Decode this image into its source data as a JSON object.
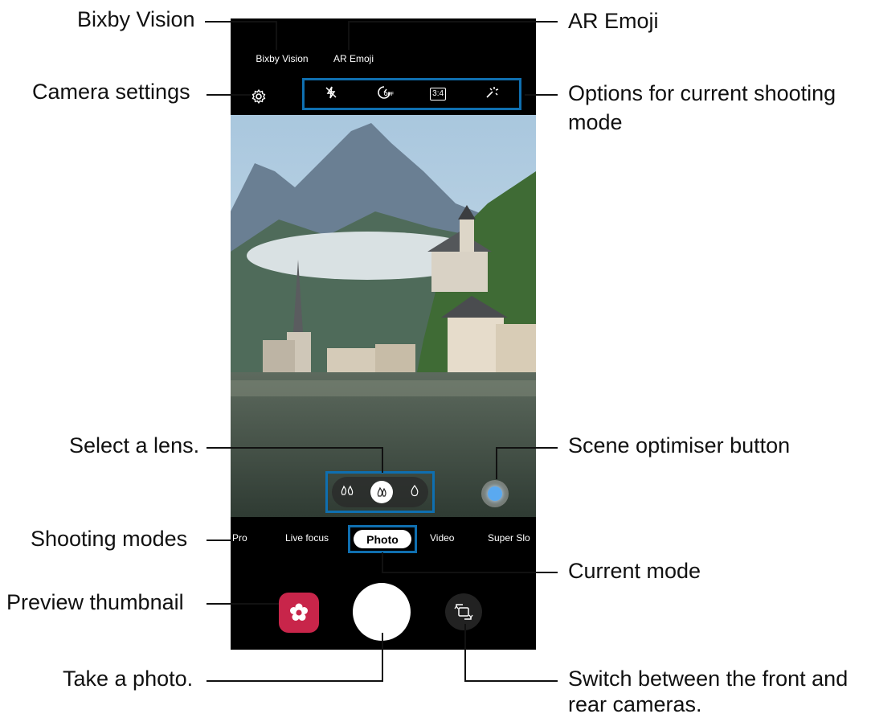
{
  "camera": {
    "top_links": {
      "bixby": "Bixby Vision",
      "ar_emoji": "AR Emoji"
    },
    "options": [
      "flash-off-icon",
      "timer-off-icon",
      "ratio-3-4-icon",
      "filter-icon"
    ],
    "ratio_label": "3:4",
    "timer_label": "OFF",
    "modes": [
      "Pro",
      "Live focus",
      "Photo",
      "Video",
      "Super Slo"
    ],
    "active_mode": "Photo"
  },
  "callouts": {
    "bixby_vision": "Bixby Vision",
    "camera_settings": "Camera settings",
    "ar_emoji": "AR Emoji",
    "options_line1": "Options for current shooting",
    "options_line2": "mode",
    "select_lens": "Select a lens.",
    "scene_optimiser": "Scene optimiser button",
    "shooting_modes": "Shooting modes",
    "current_mode": "Current mode",
    "preview_thumbnail": "Preview thumbnail",
    "take_photo": "Take a photo.",
    "switch_line1": "Switch between the front and",
    "switch_line2": "rear cameras."
  },
  "colors": {
    "highlight": "#0f6fb0",
    "gallery": "#c8254a",
    "scene": "#5aa9f0"
  }
}
